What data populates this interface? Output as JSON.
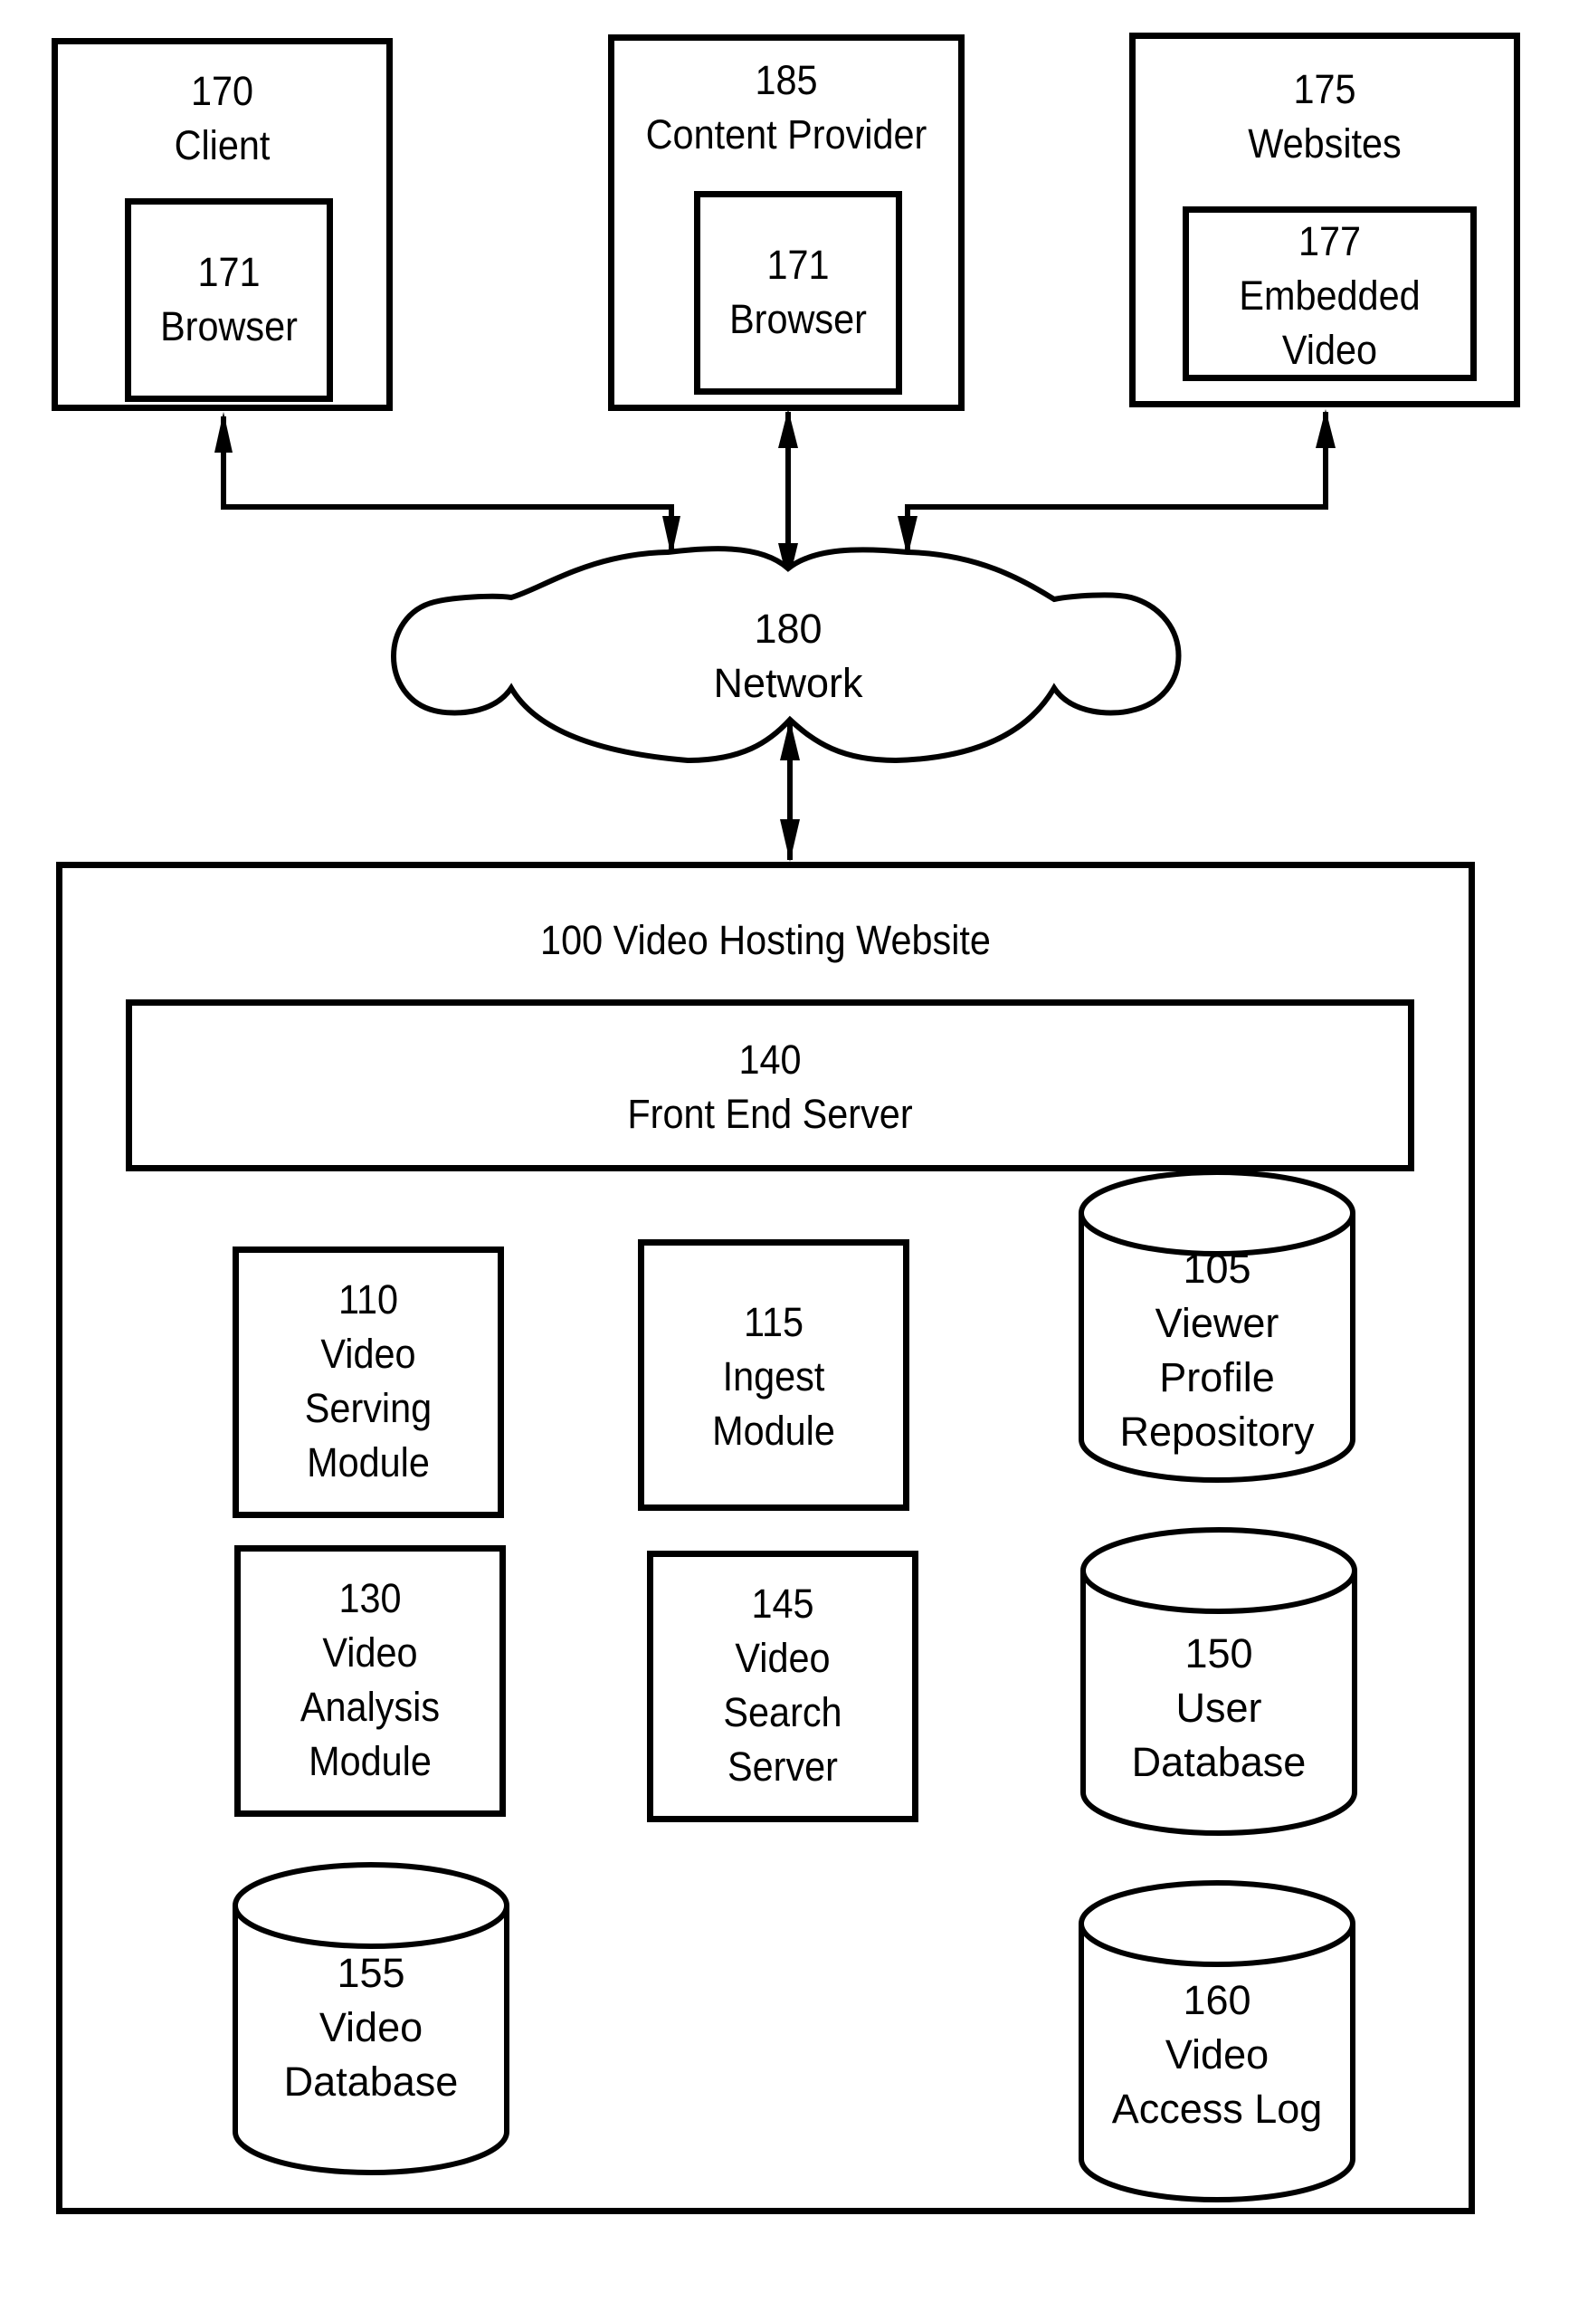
{
  "diagram": {
    "external": {
      "client": {
        "ref": "170",
        "name": "Client",
        "inner": {
          "ref": "171",
          "name": "Browser"
        }
      },
      "content_provider": {
        "ref": "185",
        "name": "Content Provider",
        "inner": {
          "ref": "171",
          "name": "Browser"
        }
      },
      "websites": {
        "ref": "175",
        "name": "Websites",
        "inner": {
          "ref": "177",
          "line1": "Embedded",
          "line2": "Video"
        }
      }
    },
    "network": {
      "ref": "180",
      "name": "Network"
    },
    "hosting": {
      "title": "100 Video Hosting Website",
      "front_end": {
        "ref": "140",
        "name": "Front End Server"
      },
      "modules": [
        {
          "ref": "110",
          "lines": [
            "Video",
            "Serving",
            "Module"
          ]
        },
        {
          "ref": "115",
          "lines": [
            "Ingest",
            "Module"
          ]
        },
        {
          "ref": "130",
          "lines": [
            "Video",
            "Analysis",
            "Module"
          ]
        },
        {
          "ref": "145",
          "lines": [
            "Video",
            "Search",
            "Server"
          ]
        }
      ],
      "stores": [
        {
          "ref": "105",
          "lines": [
            "Viewer",
            "Profile",
            "Repository"
          ]
        },
        {
          "ref": "150",
          "lines": [
            "User",
            "Database"
          ]
        },
        {
          "ref": "155",
          "lines": [
            "Video",
            "Database"
          ]
        },
        {
          "ref": "160",
          "lines": [
            "Video",
            "Access Log"
          ]
        }
      ]
    },
    "connections": [
      {
        "from": "170 Client",
        "to": "180 Network",
        "direction": "bidirectional"
      },
      {
        "from": "185 Content Provider",
        "to": "180 Network",
        "direction": "bidirectional"
      },
      {
        "from": "175 Websites",
        "to": "180 Network",
        "direction": "bidirectional"
      },
      {
        "from": "180 Network",
        "to": "100 Video Hosting Website",
        "direction": "bidirectional"
      }
    ]
  }
}
